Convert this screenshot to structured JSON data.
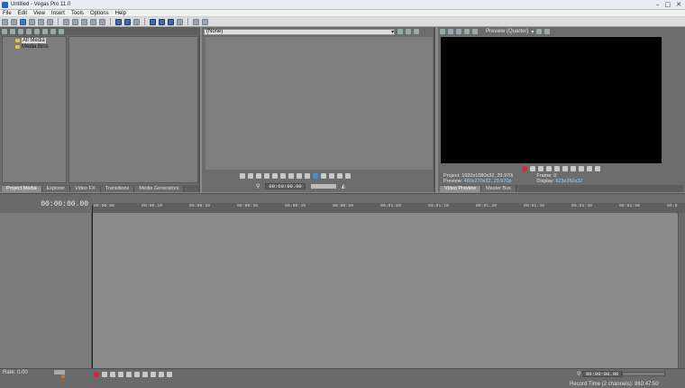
{
  "window": {
    "title": "Untitled - Vegas Pro 11.0",
    "controls": [
      "–",
      "□",
      "✕"
    ]
  },
  "menu": [
    "File",
    "Edit",
    "View",
    "Insert",
    "Tools",
    "Options",
    "Help"
  ],
  "media": {
    "tree": [
      {
        "label": "All Media",
        "selected": true
      },
      {
        "label": "Media Bins",
        "selected": false
      }
    ],
    "tabs": [
      "Project Media",
      "Explorer",
      "Video FX",
      "Transitions",
      "Media Generators"
    ]
  },
  "trimmer": {
    "select_value": "(None)",
    "timecode": "00:00:00.00"
  },
  "preview": {
    "quality": "Preview (Quarter)",
    "info": {
      "project_label": "Project:",
      "project_value": "1920x1080x32, 29.970i",
      "preview_label": "Preview:",
      "preview_value": "480x270x32, 29.970p",
      "frame_label": "Frame:",
      "frame_value": "0",
      "display_label": "Display:",
      "display_value": "623x350x32"
    },
    "tabs": [
      "Video Preview",
      "Master Bus"
    ]
  },
  "timeline": {
    "timecode": "00:00:00.00",
    "ruler": [
      "00:00:00",
      "00:00:10",
      "00:00:20",
      "00:00:30",
      "00:00:40",
      "00:00:50",
      "00:01:00",
      "00:01:10",
      "00:01:20",
      "00:01:30",
      "00:01:40",
      "00:01:50",
      "00:0"
    ],
    "rate_label": "Rate: 0.00",
    "bottom_timecode": "00:00:00.00",
    "record_time": "Record Time (2 channels): 860:47:50"
  },
  "colors": {
    "accent": "#4b8dd8",
    "record": "#dd2233",
    "preview_value": "#9fd3ff"
  }
}
